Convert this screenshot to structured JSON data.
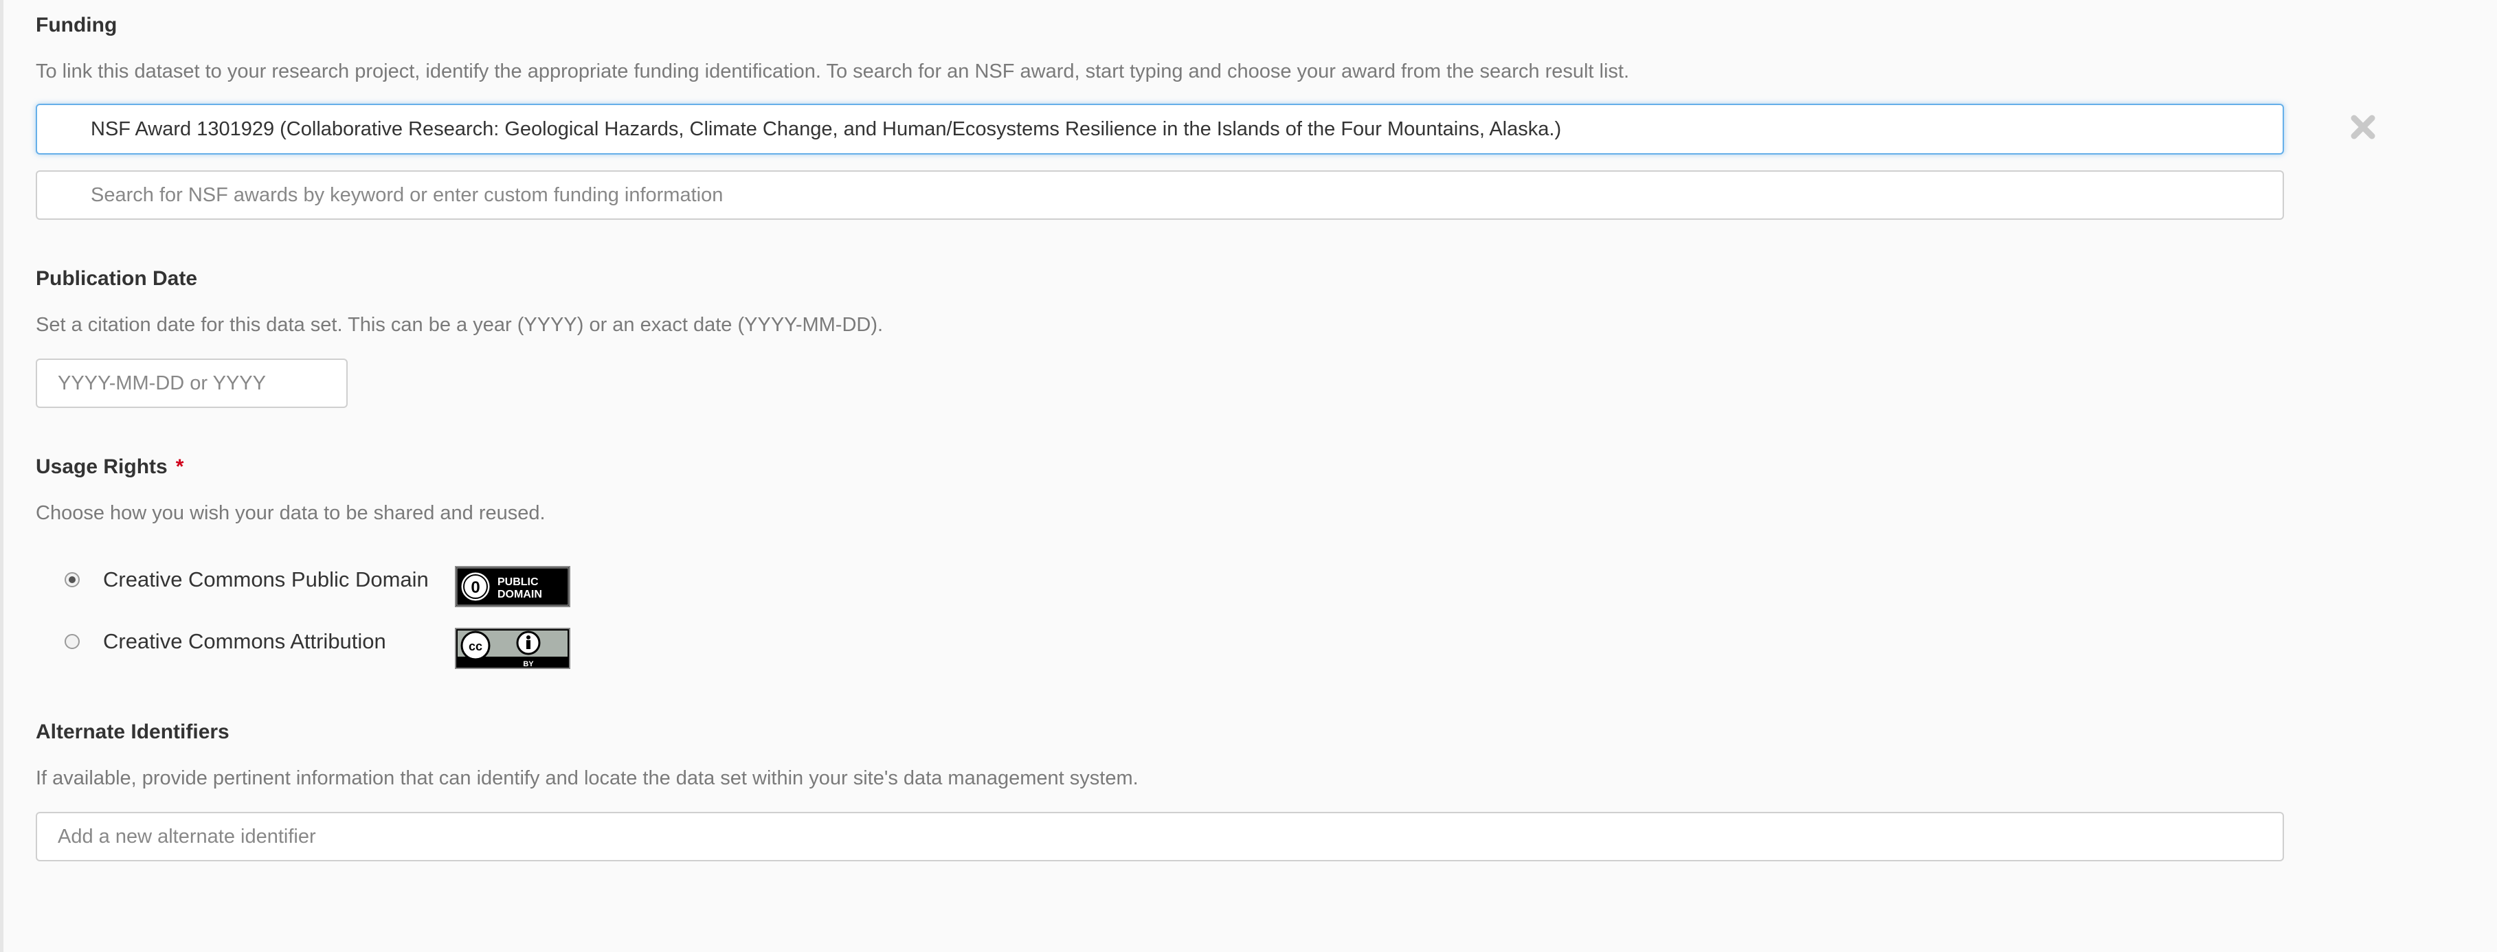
{
  "funding": {
    "heading": "Funding",
    "help": "To link this dataset to your research project, identify the appropriate funding identification. To search for an NSF award, start typing and choose your award from the search result list.",
    "award_value": "NSF Award 1301929 (Collaborative Research: Geological Hazards, Climate Change, and Human/Ecosystems Resilience in the Islands of the Four Mountains, Alaska.)",
    "search_placeholder": "Search for NSF awards by keyword or enter custom funding information",
    "remove_icon": "close-x-icon"
  },
  "publication_date": {
    "heading": "Publication Date",
    "help": "Set a citation date for this data set. This can be a year (YYYY) or an exact date (YYYY-MM-DD).",
    "placeholder": "YYYY-MM-DD or YYYY",
    "value": ""
  },
  "usage_rights": {
    "heading": "Usage Rights",
    "required_mark": "*",
    "help": "Choose how you wish your data to be shared and reused.",
    "options": [
      {
        "label": "Creative Commons Public Domain",
        "checked": true,
        "badge_text_1": "PUBLIC",
        "badge_text_2": "DOMAIN",
        "badge_symbol": "0"
      },
      {
        "label": "Creative Commons Attribution",
        "checked": false,
        "badge_symbol": "cc",
        "badge_caption": "BY"
      }
    ]
  },
  "alternate_identifiers": {
    "heading": "Alternate Identifiers",
    "help": "If available, provide pertinent information that can identify and locate the data set within your site's data management system.",
    "placeholder": "Add a new alternate identifier"
  },
  "colors": {
    "focus": "#66afe9",
    "required": "#d0021b",
    "muted": "#7a7a7a"
  }
}
